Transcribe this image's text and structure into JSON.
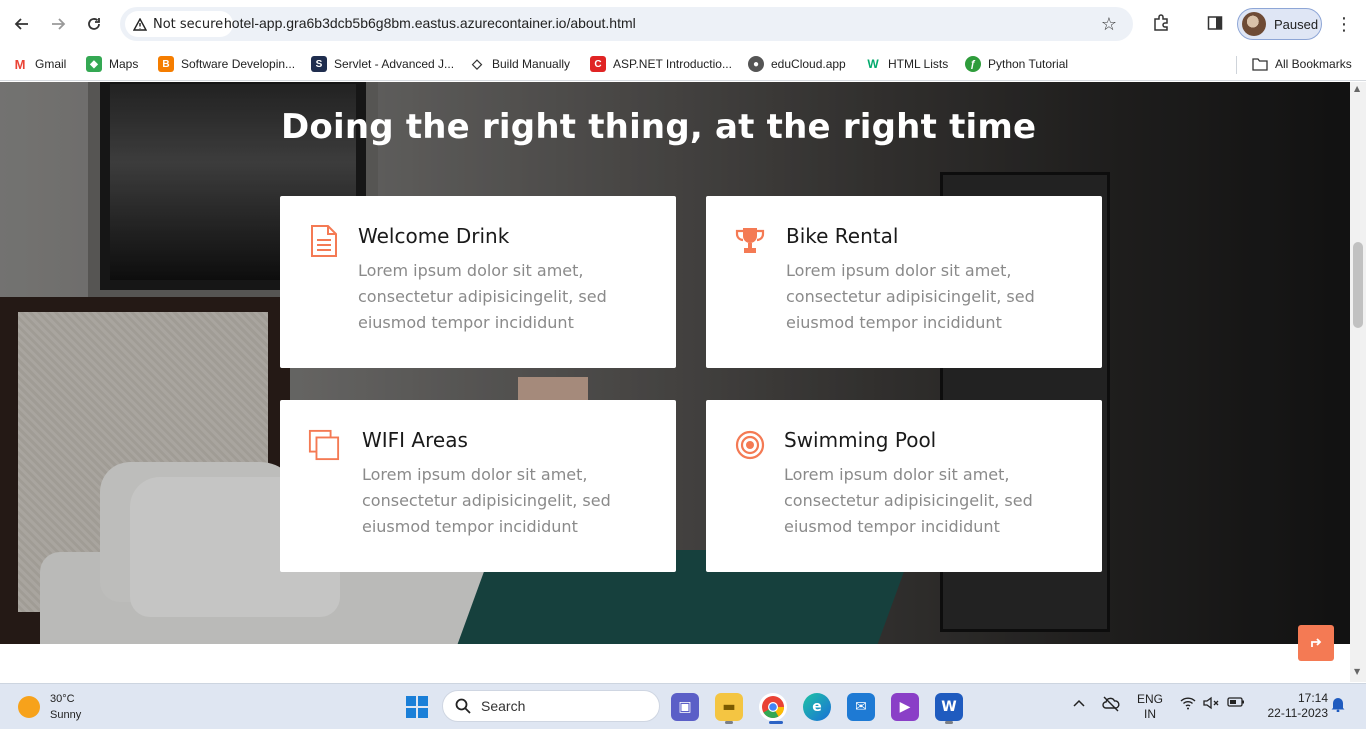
{
  "browser": {
    "security_label": "Not secure",
    "url": "hotel-app.gra6b3dcb5b6g8bm.eastus.azurecontainer.io/about.html",
    "profile_label": "Paused",
    "bookmarks": [
      {
        "label": "Gmail",
        "icon": "gmail-icon",
        "color": "#ea4335",
        "glyph": "M"
      },
      {
        "label": "Maps",
        "icon": "maps-icon",
        "color": "#34a853",
        "glyph": "◆"
      },
      {
        "label": "Software Developin...",
        "icon": "blogger-icon",
        "color": "#f57d00",
        "glyph": "B"
      },
      {
        "label": "Servlet - Advanced J...",
        "icon": "servlet-icon",
        "color": "#1f2d4e",
        "glyph": "S"
      },
      {
        "label": "Build Manually",
        "icon": "build-icon",
        "color": "#333333",
        "glyph": "◇"
      },
      {
        "label": "ASP.NET Introductio...",
        "icon": "csharp-icon",
        "color": "#e02424",
        "glyph": "C"
      },
      {
        "label": "eduCloud.app",
        "icon": "globe-icon",
        "color": "#555555",
        "glyph": "●"
      },
      {
        "label": "HTML Lists",
        "icon": "w3-icon",
        "color": "#04aa6d",
        "glyph": "W"
      },
      {
        "label": "Python Tutorial",
        "icon": "python-icon",
        "color": "#2e9c3b",
        "glyph": "ƒ"
      }
    ],
    "all_bookmarks": "All Bookmarks"
  },
  "page": {
    "heading": "Doing the right thing, at the right time",
    "accent_color": "#f47a54",
    "features": [
      {
        "title": "Welcome Drink",
        "desc": "Lorem ipsum dolor sit amet, consectetur adipisicingelit, sed eiusmod tempor incididunt",
        "icon": "document-icon"
      },
      {
        "title": "Bike Rental",
        "desc": "Lorem ipsum dolor sit amet, consectetur adipisicingelit, sed eiusmod tempor incididunt",
        "icon": "trophy-icon"
      },
      {
        "title": "WIFI Areas",
        "desc": "Lorem ipsum dolor sit amet, consectetur adipisicingelit, sed eiusmod tempor incididunt",
        "icon": "copy-icon"
      },
      {
        "title": "Swimming Pool",
        "desc": "Lorem ipsum dolor sit amet, consectetur adipisicingelit, sed eiusmod tempor incididunt",
        "icon": "target-icon"
      }
    ]
  },
  "taskbar": {
    "temperature": "30°C",
    "condition": "Sunny",
    "search_placeholder": "Search",
    "language_top": "ENG",
    "language_bottom": "IN",
    "time": "17:14",
    "date": "22-11-2023"
  }
}
